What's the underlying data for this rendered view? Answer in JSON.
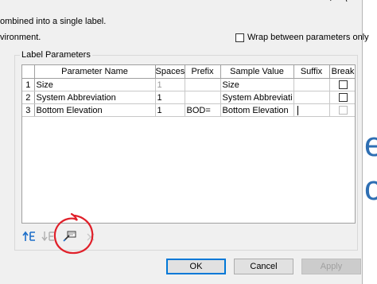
{
  "description": {
    "line1": "ombined into a single label.",
    "line2": "vironment."
  },
  "wrap_option": {
    "label": "Wrap between parameters only",
    "checked": false
  },
  "label_parameters": {
    "group_label": "Label Parameters",
    "columns": [
      "",
      "Parameter Name",
      "Spaces",
      "Prefix",
      "Sample Value",
      "Suffix",
      "Break"
    ],
    "rows": [
      {
        "num": "1",
        "name": "Size",
        "spaces": "1",
        "prefix": "",
        "sample": "Size",
        "suffix": "",
        "break_checked": false,
        "spaces_disabled": true
      },
      {
        "num": "2",
        "name": "System Abbreviation",
        "spaces": "1",
        "prefix": "",
        "sample": "System Abbreviati",
        "suffix": "",
        "break_checked": false,
        "spaces_disabled": false
      },
      {
        "num": "3",
        "name": "Bottom Elevation",
        "spaces": "1",
        "prefix": "BOD=",
        "sample": "Bottom Elevation",
        "suffix": "",
        "break_checked": false,
        "spaces_disabled": false,
        "break_disabled": true
      }
    ]
  },
  "toolbar": {
    "icons": [
      "move-up-icon",
      "move-down-icon",
      "edit-units-format-icon",
      "remove-parameter-icon"
    ]
  },
  "buttons": {
    "ok": "OK",
    "cancel": "Cancel",
    "apply": "Apply"
  },
  "background": {
    "letter1": "e",
    "letter2": "c"
  },
  "colors": {
    "accent": "#0078d7",
    "annotation": "#e0202a",
    "toolbar_blue": "#1e6fc9"
  }
}
